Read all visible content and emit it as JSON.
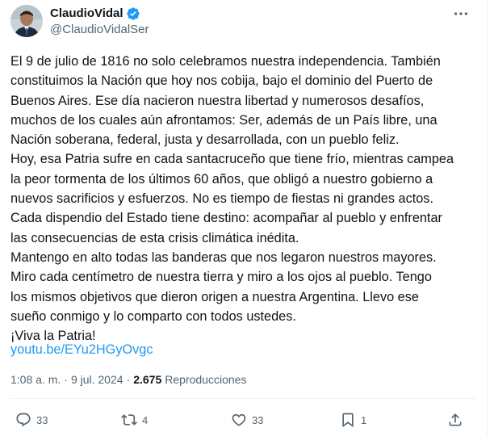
{
  "author": {
    "name": "ClaudioVidal",
    "handle": "@ClaudioVidalSer",
    "verified": true
  },
  "post": {
    "text": "El 9 de julio de 1816 no solo celebramos nuestra independencia. También\nconstituimos la Nación que hoy nos cobija, bajo el dominio del Puerto de\nBuenos Aires. Ese día nacieron nuestra libertad y numerosos desafíos,\nmuchos de los cuales aún afrontamos: Ser, además de un País libre, una\nNación soberana, federal, justa y desarrollada, con un pueblo feliz.\nHoy, esa Patria sufre en cada santacruceño que tiene frío, mientras campea\nla peor tormenta de los últimos 60 años, que obligó a nuestro gobierno a\nnuevos sacrificios y esfuerzos. No es tiempo de fiestas ni grandes actos.\nCada dispendio del Estado tiene destino: acompañar al pueblo y enfrentar\nlas consecuencias de esta crisis climática inédita.\nMantengo en alto todas las banderas que nos legaron nuestros mayores.\nMiro cada centímetro de nuestra tierra y miro a los ojos al pueblo. Tengo\nlos mismos objetivos que dieron origen a nuestra Argentina. Llevo ese\nsueño conmigo y lo comparto con todos ustedes.\n¡Viva la Patria!",
    "link": "youtu.be/EYu2HGyOvgc"
  },
  "meta": {
    "time": "1:08 a. m.",
    "separator": "·",
    "date": "9 jul. 2024",
    "separator2": "·",
    "views_count": "2.675",
    "views_label": "Reproducciones"
  },
  "actions": {
    "replies": "33",
    "reposts": "4",
    "likes": "33",
    "bookmarks": "1"
  },
  "colors": {
    "text": "#0f1419",
    "secondary": "#536471",
    "link": "#1d9bf0",
    "verified": "#1d9bf0"
  },
  "icons": {
    "reply": "reply-icon",
    "repost": "repost-icon",
    "like": "heart-icon",
    "bookmark": "bookmark-icon",
    "share": "share-icon",
    "more": "more-icon",
    "verified": "verified-badge-icon"
  }
}
